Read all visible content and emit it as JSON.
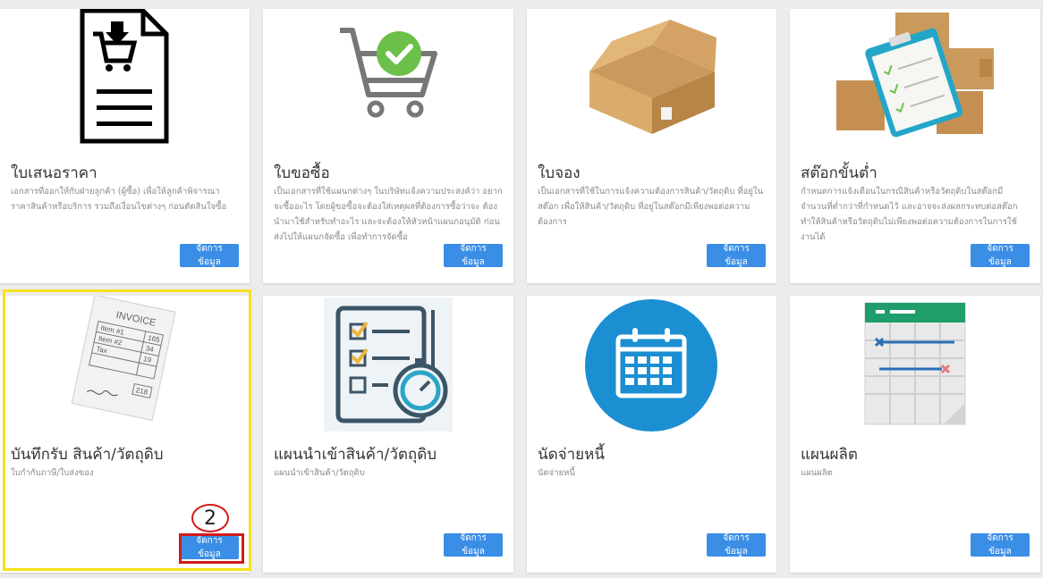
{
  "cards": [
    {
      "title": "ใบเสนอราคา",
      "desc": "เอกสารที่ออกให้กับฝ่ายลูกค้า (ผู้ซื้อ) เพื่อให้ลูกค้าพิจารณา ราคาสินค้าหรือบริการ รวมถึงเงื่อนไขต่างๆ ก่อนตัดสินใจซื้อ",
      "button": "จัดการข้อมูล",
      "icon": "quotation-document-icon"
    },
    {
      "title": "ใบขอซื้อ",
      "desc": "เป็นเอกสารที่ใช้แผนกต่างๆ ในบริษัทแจ้งความประสงค์ว่า อยากจะซื้ออะไร โดยผู้ขอซื้อจะต้องใส่เหตุผลที่ต้องการซื้อว่าจะ ต้องนำมาใช้สำหรับทำอะไร และจะต้องให้หัวหน้าแผนกอนุมัติ ก่อนส่งไปให้แผนกจัดซื้อ เพื่อทำการจัดซื้อ",
      "button": "จัดการข้อมูล",
      "icon": "cart-check-icon"
    },
    {
      "title": "ใบจอง",
      "desc": "เป็นเอกสารที่ใช้ในการแจ้งความต้องการสินค้า/วัตถุดิบ ที่อยู่ใน สต๊อก เพื่อให้สินค้า/วัตถุดิบ ที่อยู่ในสต๊อกมีเพียงพอต่อความ ต้องการ",
      "button": "จัดการข้อมูล",
      "icon": "open-box-icon"
    },
    {
      "title": "สต๊อกขั้นต่ำ",
      "desc": "กำหนดการแจ้งเตือนในกรณีสินค้าหรือวัตถุดิบในสต๊อกมี จำนวนที่ต่ำกว่าที่กำหนดไว้ และอาจจะส่งผลกระทบต่อสต๊อก ทำให้สินค้าหรือวัตถุดิบไม่เพียงพอต่อความต้องการในการใช้ งานได้",
      "button": "จัดการข้อมูล",
      "icon": "boxes-clipboard-icon"
    },
    {
      "title": "บันทึกรับ สินค้า/วัตถุดิบ",
      "desc": "ใบกำกับภาษี/ใบส่งของ",
      "button": "จัดการข้อมูล",
      "icon": "invoice-icon",
      "invoice_heading": "INVOICE",
      "invoice_lines": [
        "Item #1",
        "Item #2",
        "Tax"
      ],
      "invoice_amounts": [
        "165",
        "34",
        "19"
      ],
      "invoice_total": "218"
    },
    {
      "title": "แผนนำเข้าสินค้า/วัตถุดิบ",
      "desc": "แผนนำเข้าสินค้า/วัตถุดิบ",
      "button": "จัดการข้อมูล",
      "icon": "checklist-stopwatch-icon"
    },
    {
      "title": "นัดจ่ายหนี้",
      "desc": "นัดจ่ายหนี้",
      "button": "จัดการข้อมูล",
      "icon": "calendar-icon"
    },
    {
      "title": "แผนผลิต",
      "desc": "แผนผลิต",
      "button": "จัดการข้อมูล",
      "icon": "spreadsheet-icon"
    }
  ],
  "annotation": {
    "step_number": "2",
    "highlight_color": "#f5e21a",
    "marker_color": "#d21919"
  },
  "colors": {
    "button": "#3a8ee6",
    "check_green": "#6cc04a",
    "calendar_blue": "#1b8fd2",
    "sheet_green": "#1f9d6b"
  }
}
